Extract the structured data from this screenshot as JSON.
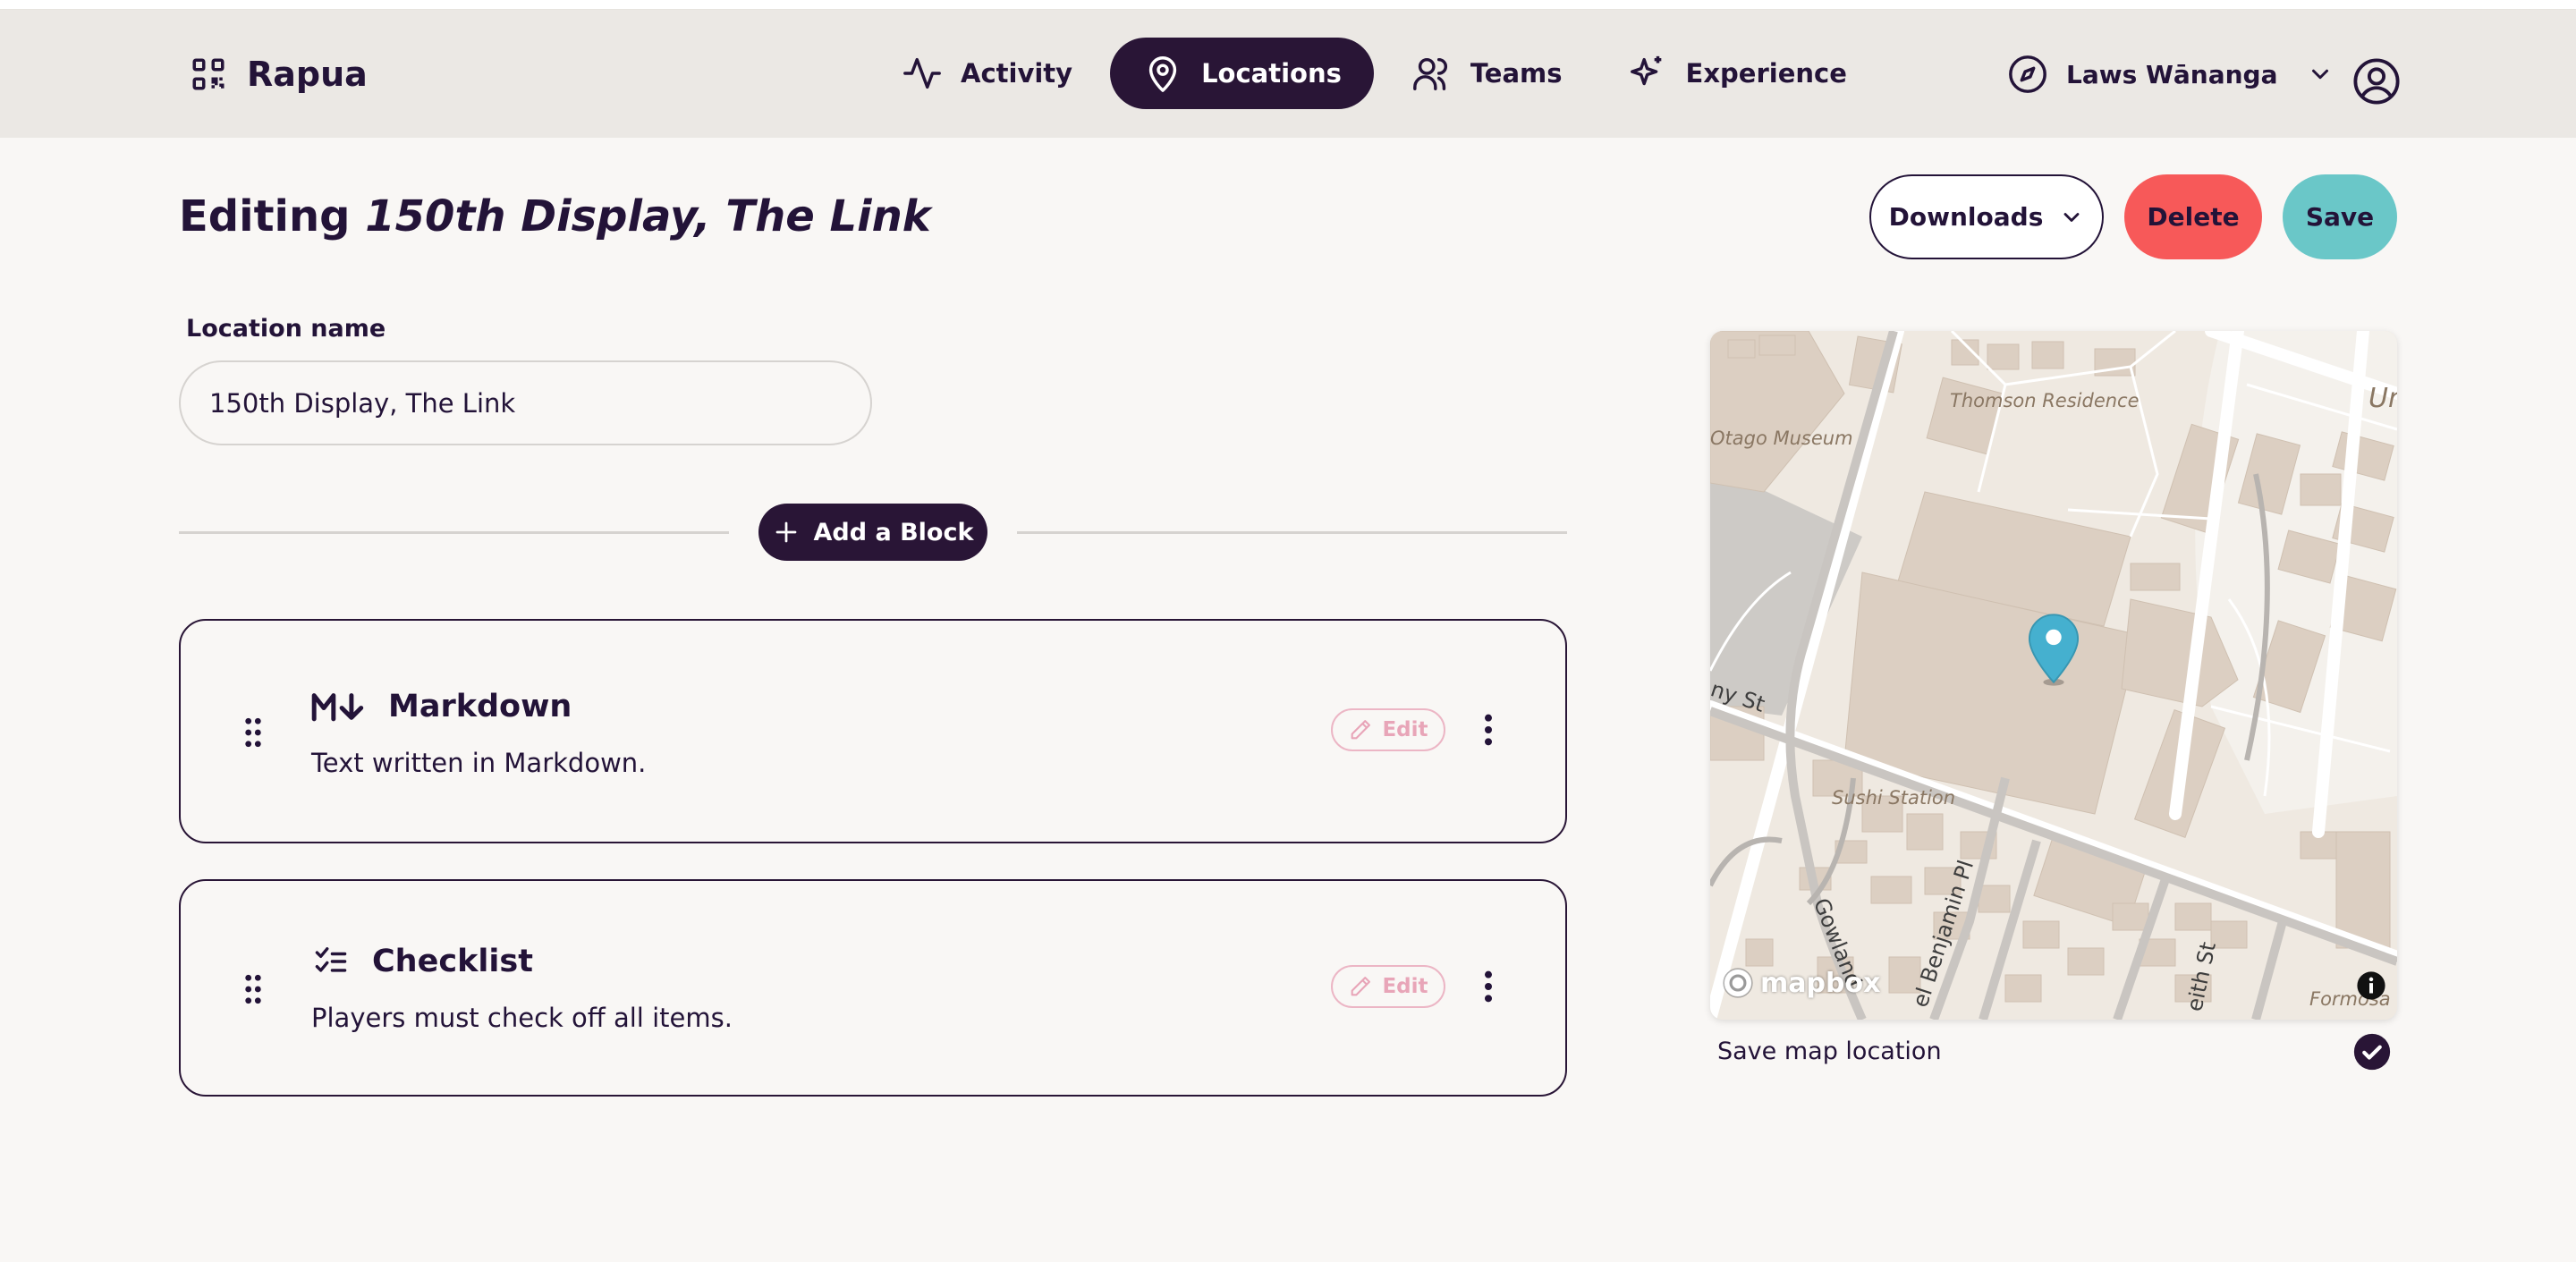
{
  "app": {
    "name": "Rapua"
  },
  "nav": {
    "items": [
      {
        "label": "Activity",
        "icon": "activity-icon",
        "active": false
      },
      {
        "label": "Locations",
        "icon": "map-pin-icon",
        "active": true
      },
      {
        "label": "Teams",
        "icon": "users-icon",
        "active": false
      },
      {
        "label": "Experience",
        "icon": "sparkles-icon",
        "active": false
      }
    ]
  },
  "workspace": {
    "name": "Laws Wānanga",
    "icon": "compass-icon"
  },
  "page": {
    "title_prefix": "Editing",
    "title_location": "150th Display, The Link"
  },
  "actions": {
    "downloads": "Downloads",
    "delete": "Delete",
    "save": "Save"
  },
  "form": {
    "location_name_label": "Location name",
    "location_name_value": "150th Display, The Link"
  },
  "add_block": {
    "label": "Add a Block"
  },
  "blocks": [
    {
      "icon": "markdown-icon",
      "title": "Markdown",
      "description": "Text written in Markdown.",
      "edit_label": "Edit"
    },
    {
      "icon": "checklist-icon",
      "title": "Checklist",
      "description": "Players must check off all items.",
      "edit_label": "Edit"
    }
  ],
  "map": {
    "labels": [
      "Thomson Residence",
      "Otago Museum",
      "Sushi Station",
      "Un",
      "Formosa"
    ],
    "roads": [
      "ny St",
      "Gowland",
      "el Benjamin Pl",
      "eith St"
    ],
    "attribution": "mapbox",
    "pin_color": "#45b0cf"
  },
  "save_map_location": {
    "label": "Save map location",
    "checked": true
  },
  "colors": {
    "primary": "#291536",
    "delete": "#f75959",
    "save": "#6ac7c8",
    "edit": "#e8a5b8"
  }
}
